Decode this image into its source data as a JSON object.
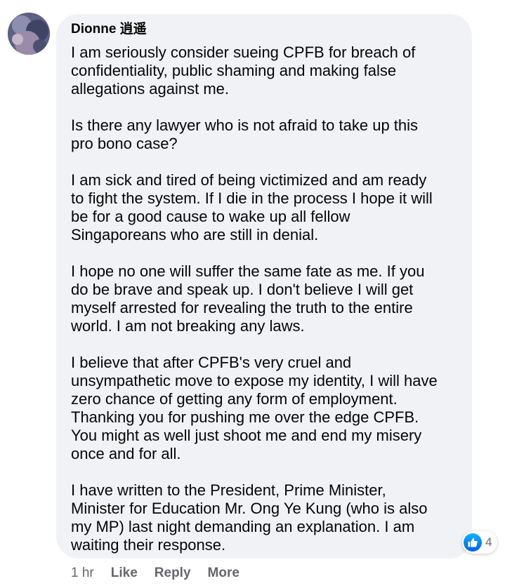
{
  "comment": {
    "author": "Dionne 逍遥",
    "paragraphs": [
      [
        "I am seriously consider sueing CPFB for breach of",
        "confidentiality, public shaming and making false",
        "allegations against me."
      ],
      [
        "Is there any lawyer who is not afraid to take up this",
        "pro bono case?"
      ],
      [
        "I am sick and tired of being victimized and am ready",
        "to fight the system. If I die in the process I hope it will",
        "be for a good cause to wake up all fellow",
        "Singaporeans who are still in denial."
      ],
      [
        "I hope no one will suffer the same fate as me. If you",
        "do be brave and speak up. I don't believe I will get",
        "myself arrested for revealing the truth to the entire",
        "world. I am not breaking any laws."
      ],
      [
        "I believe that after CPFB's very cruel and",
        "unsympathetic move to expose my identity, I will have",
        "zero chance of getting any form of employment.",
        "Thanking you for pushing me over the edge CPFB.",
        "You might as well just shoot me and end my misery",
        "once and for all."
      ],
      [
        "I have written to the President, Prime Minister,",
        "Minister for Education Mr. Ong Ye Kung (who is also",
        "my MP) last night demanding an explanation. I am",
        "waiting their response."
      ]
    ],
    "reactions": {
      "icon": "like-icon",
      "count": "4",
      "color": "#1877f2"
    },
    "actions": {
      "time": "1 hr",
      "like": "Like",
      "reply": "Reply",
      "more": "More"
    }
  }
}
